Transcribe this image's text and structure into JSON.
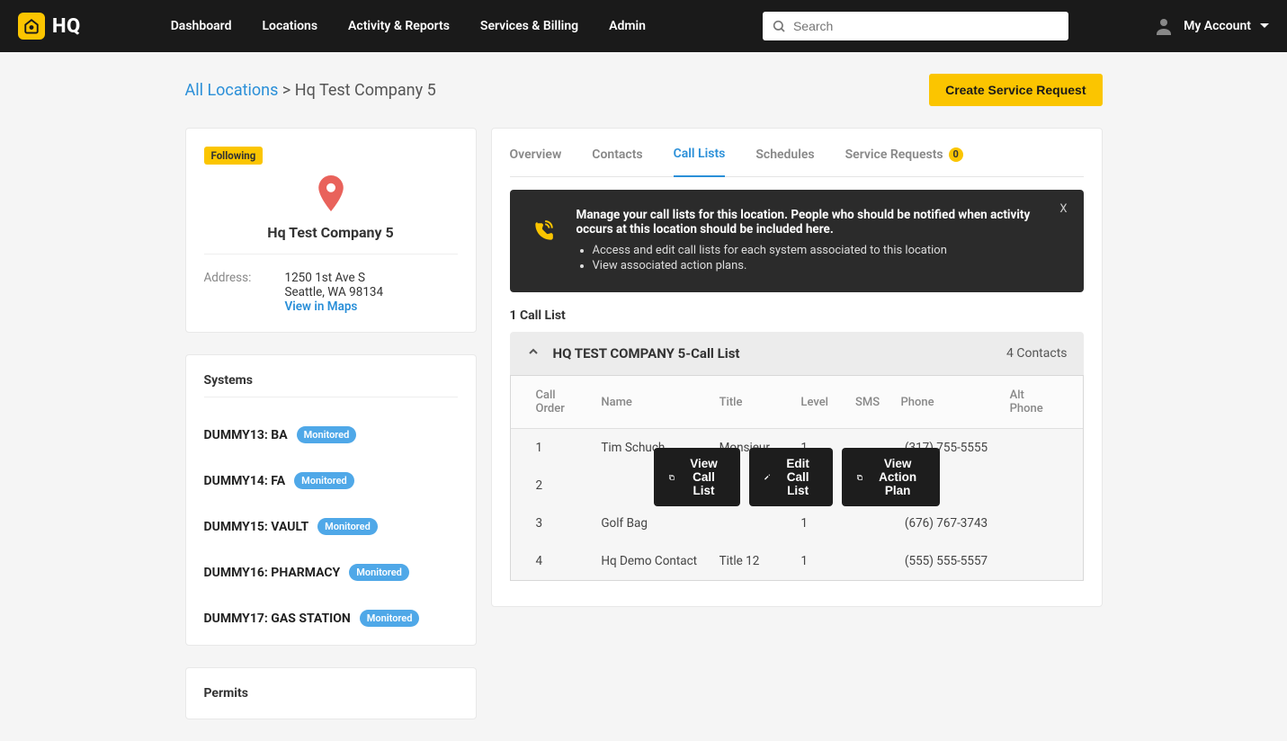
{
  "brand": "HQ",
  "nav": {
    "items": [
      "Dashboard",
      "Locations",
      "Activity & Reports",
      "Services & Billing",
      "Admin"
    ]
  },
  "search": {
    "placeholder": "Search"
  },
  "account": {
    "label": "My Account"
  },
  "breadcrumb": {
    "root": "All Locations",
    "sep": ">",
    "current": "Hq Test Company 5"
  },
  "create_btn": "Create Service Request",
  "location": {
    "following": "Following",
    "name": "Hq Test Company 5",
    "addr_label": "Address:",
    "addr_line1": "1250 1st Ave S",
    "addr_line2": "Seattle, WA 98134",
    "maps_link": "View in Maps"
  },
  "systems": {
    "title": "Systems",
    "chip": "Monitored",
    "items": [
      {
        "name": "DUMMY13: BA"
      },
      {
        "name": "DUMMY14: FA"
      },
      {
        "name": "DUMMY15: VAULT"
      },
      {
        "name": "DUMMY16: PHARMACY"
      },
      {
        "name": "DUMMY17: GAS STATION"
      }
    ]
  },
  "permits": {
    "title": "Permits"
  },
  "tabs": [
    {
      "label": "Overview",
      "active": false
    },
    {
      "label": "Contacts",
      "active": false
    },
    {
      "label": "Call Lists",
      "active": true
    },
    {
      "label": "Schedules",
      "active": false
    },
    {
      "label": "Service Requests",
      "active": false,
      "badge": "0"
    }
  ],
  "banner": {
    "headline": "Manage your call lists for this location. People who should be notified when activity occurs at this location should be included here.",
    "bullets": [
      "Access and edit call lists for each system associated to this location",
      "View associated action plans."
    ],
    "close": "X"
  },
  "call_list": {
    "count_label": "1 Call List",
    "heading": "HQ TEST COMPANY 5-Call List",
    "contacts_count": "4 Contacts",
    "columns": [
      "Call Order",
      "Name",
      "Title",
      "Level",
      "SMS",
      "Phone",
      "Alt Phone"
    ],
    "rows": [
      {
        "order": "1",
        "name": "Tim Schuch",
        "title": "Monsieur",
        "level": "1",
        "sms": "",
        "phone": "(317) 755-5555",
        "alt": ""
      },
      {
        "order": "2",
        "name": "",
        "title": "",
        "level": "",
        "sms": "",
        "phone": "",
        "alt": ""
      },
      {
        "order": "3",
        "name": "Golf Bag",
        "title": "",
        "level": "1",
        "sms": "",
        "phone": "(676) 767-3743",
        "alt": ""
      },
      {
        "order": "4",
        "name": "Hq Demo Contact",
        "title": "Title 12",
        "level": "1",
        "sms": "",
        "phone": "(555) 555-5557",
        "alt": ""
      }
    ],
    "actions": {
      "view": "View Call List",
      "edit": "Edit Call List",
      "plan": "View Action Plan"
    }
  }
}
